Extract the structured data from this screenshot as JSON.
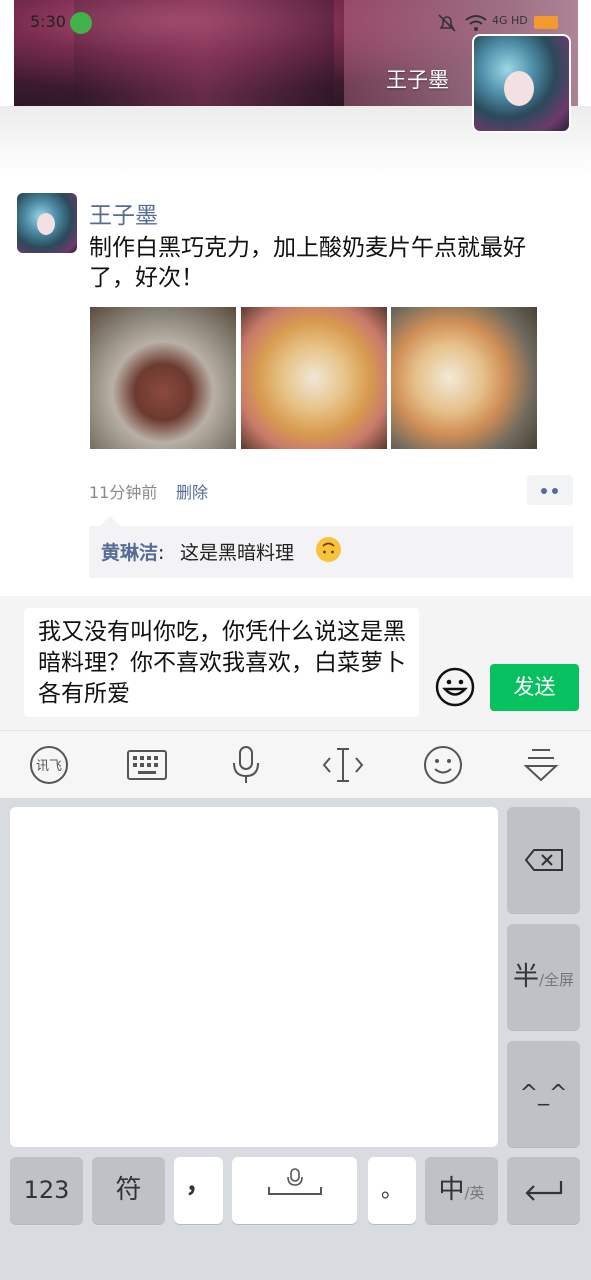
{
  "status_bar": {
    "time": "5:30",
    "network": "4G HD"
  },
  "cover": {
    "username": "王子墨"
  },
  "post": {
    "author": "王子墨",
    "text": "制作白黑巧克力，加上酸奶麦片午点就最好了，好次！",
    "time_ago": "11分钟前",
    "delete_label": "删除",
    "photos": [
      "photo-1",
      "photo-2",
      "photo-3"
    ]
  },
  "comment": {
    "author": "黄琳洁",
    "separator": ":",
    "text": " 这是黑暗料理"
  },
  "input": {
    "text": "我又没有叫你吃，你凭什么说这是黑暗料理？你不喜欢我喜欢，白菜萝卜各有所爱",
    "send_label": "发送"
  },
  "keyboard": {
    "toolbar_icons": [
      "xunfei-logo-icon",
      "keyboard-icon",
      "microphone-icon",
      "cursor-icon",
      "smiley-icon",
      "collapse-keyboard-icon"
    ],
    "half_label": "半",
    "half_sub": "/全屏",
    "face_label": "^_^",
    "num_label": "123",
    "symbol_label": "符",
    "comma_label": "，",
    "period_label": "。",
    "lang_label": "中",
    "lang_sub": "/英"
  },
  "colors": {
    "accent": "#07c160",
    "link": "#586b95",
    "battery": "#f39a2e"
  }
}
